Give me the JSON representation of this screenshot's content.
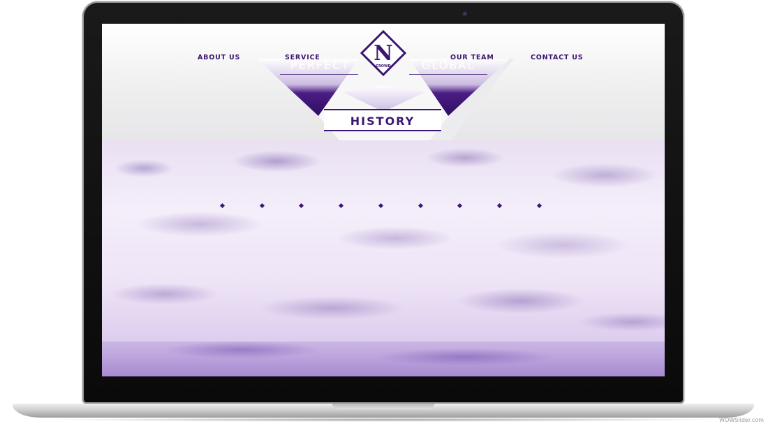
{
  "nav": {
    "about": "ABOUT US",
    "service": "SERVICE",
    "team": "OUR TEAM",
    "contact": "CONTACT US"
  },
  "logo": {
    "letter": "N",
    "subtext": "CROWD"
  },
  "hero": {
    "left_tag": "PERFECT",
    "right_tag": "GLOBAL",
    "center_label": "HISTORY"
  },
  "slider": {
    "dot_count": 9,
    "active_index": null
  },
  "watermark": "WOWSlider.com",
  "colors": {
    "brand_purple": "#3b1670",
    "cloud_tint": "#d9c9ec"
  }
}
